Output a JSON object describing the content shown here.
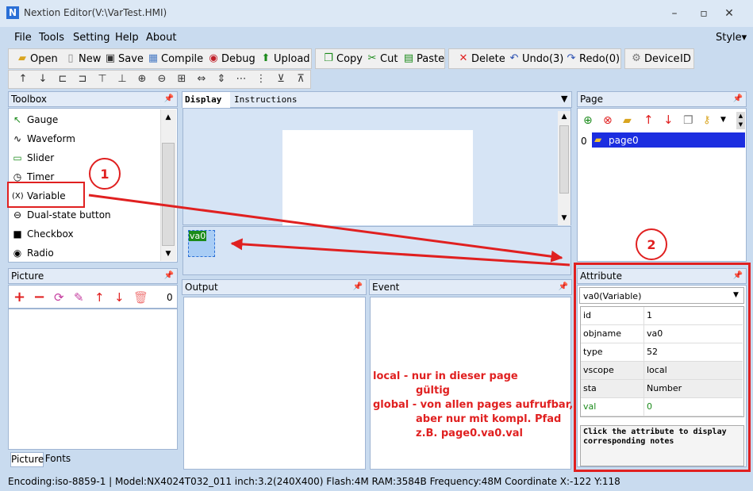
{
  "window": {
    "title": "Nextion Editor(V:\\VarTest.HMI)",
    "app_icon": "N",
    "minimize": "–",
    "maximize": "▫",
    "close": "✕"
  },
  "menu": {
    "items": [
      "File",
      "Tools",
      "Setting",
      "Help",
      "About"
    ],
    "style": "Style▾"
  },
  "toolbar": {
    "open": "Open",
    "new": "New",
    "save": "Save",
    "compile": "Compile",
    "debug": "Debug",
    "upload": "Upload",
    "copy": "Copy",
    "cut": "Cut",
    "paste": "Paste",
    "delete": "Delete",
    "undo": "Undo(3)",
    "redo": "Redo(0)",
    "device": "Device",
    "id": "ID"
  },
  "toolbox": {
    "title": "Toolbox",
    "items": [
      {
        "label": "Gauge",
        "icon": "gauge-icon",
        "glyph": "↖"
      },
      {
        "label": "Waveform",
        "icon": "waveform-icon",
        "glyph": "∿"
      },
      {
        "label": "Slider",
        "icon": "slider-icon",
        "glyph": "▭"
      },
      {
        "label": "Timer",
        "icon": "timer-icon",
        "glyph": "◷"
      },
      {
        "label": "Variable",
        "icon": "variable-icon",
        "glyph": "(X)"
      },
      {
        "label": "Dual-state button",
        "icon": "dual-state-button-icon",
        "glyph": "⊖"
      },
      {
        "label": "Checkbox",
        "icon": "checkbox-icon",
        "glyph": "■"
      },
      {
        "label": "Radio",
        "icon": "radio-icon",
        "glyph": "◉"
      }
    ]
  },
  "picture": {
    "title": "Picture",
    "count": "0"
  },
  "bottom_tabs": {
    "picture": "Picture",
    "fonts": "Fonts"
  },
  "display": {
    "tab_display": "Display",
    "tab_instructions": "Instructions",
    "component_label": "va0"
  },
  "output": {
    "title": "Output"
  },
  "event": {
    "title": "Event",
    "note_lines": [
      "local - nur in dieser page",
      "gültig",
      "global - von allen pages aufrufbar,",
      "aber nur mit kompl. Pfad",
      "z.B. page0.va0.val"
    ]
  },
  "page": {
    "title": "Page",
    "items": [
      {
        "index": "0",
        "name": "page0"
      }
    ]
  },
  "attribute": {
    "title": "Attribute",
    "selected": "va0(Variable)",
    "rows": [
      {
        "key": "id",
        "value": "1",
        "color": "#000000"
      },
      {
        "key": "objname",
        "value": "va0",
        "color": "#000000"
      },
      {
        "key": "type",
        "value": "52",
        "color": "#000000"
      },
      {
        "key": "vscope",
        "value": "local",
        "color": "#000000"
      },
      {
        "key": "sta",
        "value": "Number",
        "color": "#000000"
      },
      {
        "key": "val",
        "value": "0",
        "color": "#1a8a1a"
      }
    ],
    "note": "Click the attribute to display corresponding notes"
  },
  "annotations": {
    "marker1": "1",
    "marker2": "2",
    "color": "#e02020"
  },
  "status": {
    "text": "Encoding:iso-8859-1 | Model:NX4024T032_011  inch:3.2(240X400) Flash:4M RAM:3584B Frequency:48M     Coordinate X:-122  Y:118"
  }
}
